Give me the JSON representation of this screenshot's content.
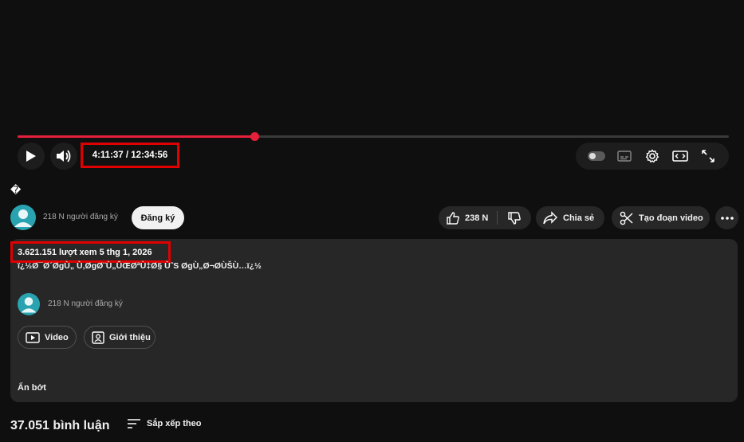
{
  "player": {
    "progress_fraction": 0.3335,
    "time_display": "4:11:37 / 12:34:56",
    "accent_color": "#e5203a",
    "icons": [
      "play-icon",
      "volume-icon",
      "autoplay-toggle",
      "captions-icon",
      "settings-gear-icon",
      "theater-mode-icon",
      "fullscreen-icon"
    ]
  },
  "video": {
    "title": "�"
  },
  "channel": {
    "subscribers": "218 N người đăng ký",
    "subscribe_label": "Đăng ký"
  },
  "actions": {
    "like_count": "238 N",
    "share_label": "Chia sẻ",
    "clip_label": "Tạo đoạn video"
  },
  "description": {
    "meta": "3.621.151 lượt xem  5 thg 1, 2026",
    "text": "ï¿½Ø¯Ø´ØgÙ„ Ù‚ØgØ¨Ù„ÛŒØªÙ‡Ø§ ÙˆS ØgÙ„Ø¬ØÙŠÙ…ï¿½",
    "channel_subscribers": "218 N người đăng ký",
    "video_tab_label": "Video",
    "about_tab_label": "Giới thiệu",
    "show_less_label": "Ẩn bớt"
  },
  "comments": {
    "count_label": "37.051 bình luận",
    "sort_label": "Sắp xếp theo"
  }
}
